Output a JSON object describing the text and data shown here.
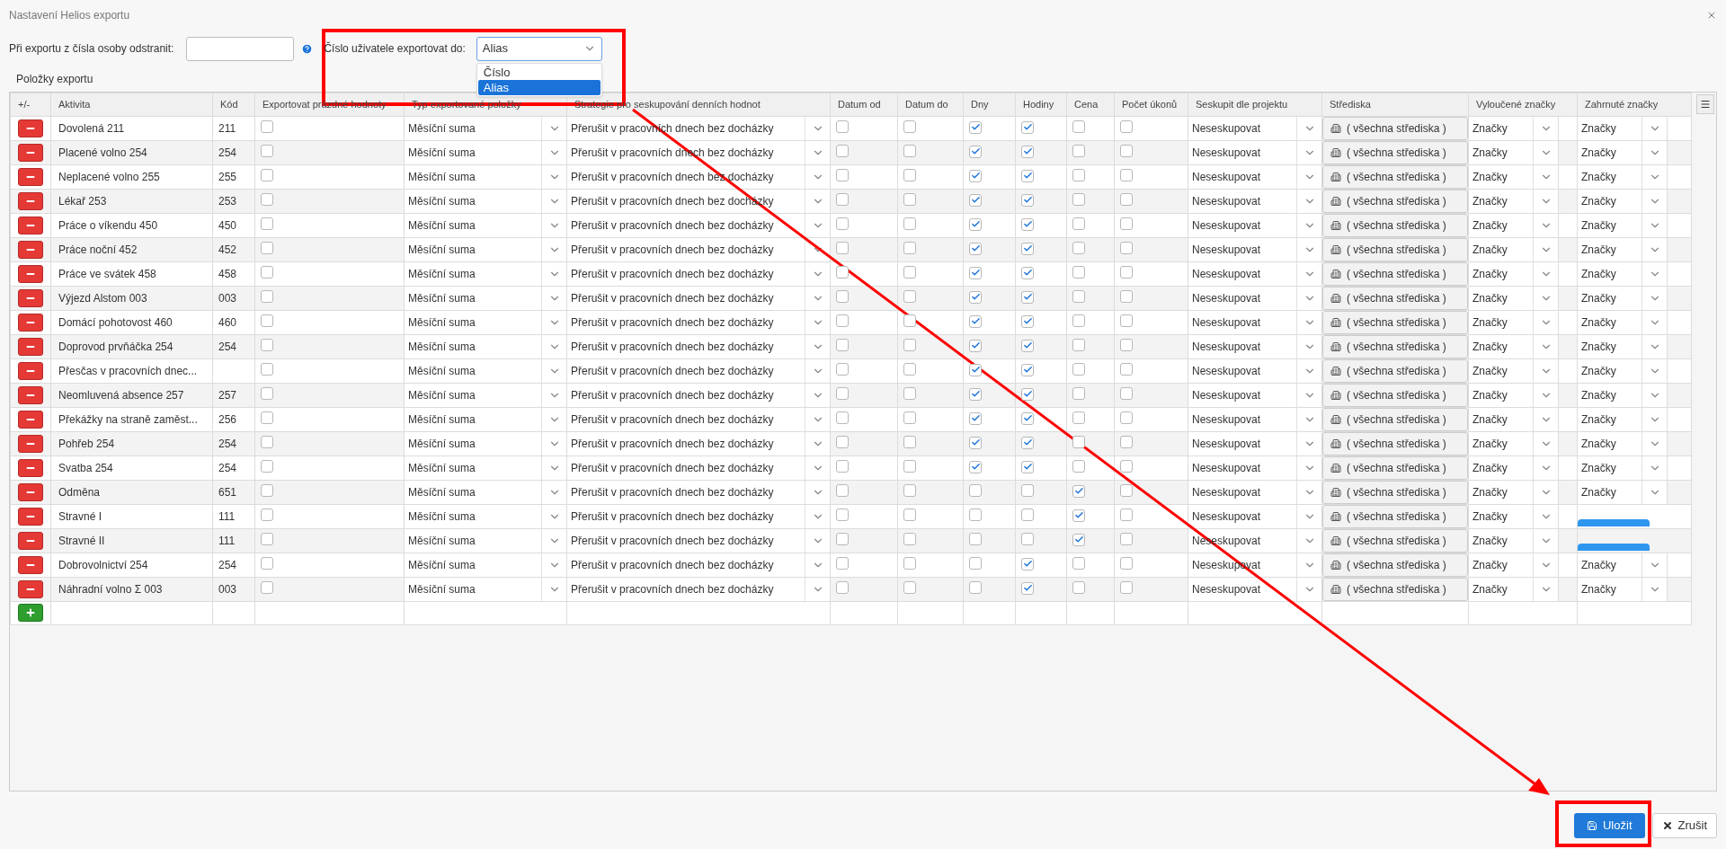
{
  "window": {
    "title": "Nastavení Helios exportu"
  },
  "form": {
    "remove_label": "Při exportu z čísla osoby odstranit:",
    "user_number_label": "Číslo uživatele exportovat do:",
    "user_number_value": "Alias",
    "dropdown_open": true,
    "options": [
      {
        "label": "Číslo",
        "selected": false
      },
      {
        "label": "Alias",
        "selected": true
      }
    ]
  },
  "section_title": "Položky exportu",
  "columns": [
    "+/-",
    "Aktivita",
    "Kód",
    "Exportovat prázdné hodnoty",
    "Typ exportované položky",
    "Strategie pro seskupování denních hodnot",
    "Datum od",
    "Datum do",
    "Dny",
    "Hodiny",
    "Cena",
    "Počet úkonů",
    "Seskupit dle projektu",
    "Střediska",
    "Vyloučené značky",
    "Zahrnuté značky"
  ],
  "rows": [
    {
      "activity": "Dovolená 211",
      "code": "211",
      "export_empty": false,
      "type": "Měsíční suma",
      "strategy": "Přerušit v pracovních dnech bez docházky",
      "date_from": false,
      "date_to": false,
      "days": true,
      "hours": true,
      "price": false,
      "count": false,
      "group": "Neseskupovat",
      "centers": "( všechna střediska )",
      "excluded": "Značky",
      "included": "Značky"
    },
    {
      "activity": "Placené volno 254",
      "code": "254",
      "export_empty": false,
      "type": "Měsíční suma",
      "strategy": "Přerušit v pracovních dnech bez docházky",
      "date_from": false,
      "date_to": false,
      "days": true,
      "hours": true,
      "price": false,
      "count": false,
      "group": "Neseskupovat",
      "centers": "( všechna střediska )",
      "excluded": "Značky",
      "included": "Značky"
    },
    {
      "activity": "Neplacené volno 255",
      "code": "255",
      "export_empty": false,
      "type": "Měsíční suma",
      "strategy": "Přerušit v pracovních dnech bez docházky",
      "date_from": false,
      "date_to": false,
      "days": true,
      "hours": true,
      "price": false,
      "count": false,
      "group": "Neseskupovat",
      "centers": "( všechna střediska )",
      "excluded": "Značky",
      "included": "Značky"
    },
    {
      "activity": "Lékař 253",
      "code": "253",
      "export_empty": false,
      "type": "Měsíční suma",
      "strategy": "Přerušit v pracovních dnech bez docházky",
      "date_from": false,
      "date_to": false,
      "days": true,
      "hours": true,
      "price": false,
      "count": false,
      "group": "Neseskupovat",
      "centers": "( všechna střediska )",
      "excluded": "Značky",
      "included": "Značky"
    },
    {
      "activity": "Práce o víkendu 450",
      "code": "450",
      "export_empty": false,
      "type": "Měsíční suma",
      "strategy": "Přerušit v pracovních dnech bez docházky",
      "date_from": false,
      "date_to": false,
      "days": true,
      "hours": true,
      "price": false,
      "count": false,
      "group": "Neseskupovat",
      "centers": "( všechna střediska )",
      "excluded": "Značky",
      "included": "Značky"
    },
    {
      "activity": "Práce noční 452",
      "code": "452",
      "export_empty": false,
      "type": "Měsíční suma",
      "strategy": "Přerušit v pracovních dnech bez docházky",
      "date_from": false,
      "date_to": false,
      "days": true,
      "hours": true,
      "price": false,
      "count": false,
      "group": "Neseskupovat",
      "centers": "( všechna střediska )",
      "excluded": "Značky",
      "included": "Značky"
    },
    {
      "activity": "Práce ve svátek 458",
      "code": "458",
      "export_empty": false,
      "type": "Měsíční suma",
      "strategy": "Přerušit v pracovních dnech bez docházky",
      "date_from": false,
      "date_to": false,
      "days": true,
      "hours": true,
      "price": false,
      "count": false,
      "group": "Neseskupovat",
      "centers": "( všechna střediska )",
      "excluded": "Značky",
      "included": "Značky"
    },
    {
      "activity": "Výjezd Alstom 003",
      "code": "003",
      "export_empty": false,
      "type": "Měsíční suma",
      "strategy": "Přerušit v pracovních dnech bez docházky",
      "date_from": false,
      "date_to": false,
      "days": true,
      "hours": true,
      "price": false,
      "count": false,
      "group": "Neseskupovat",
      "centers": "( všechna střediska )",
      "excluded": "Značky",
      "included": "Značky"
    },
    {
      "activity": "Domácí pohotovost 460",
      "code": "460",
      "export_empty": false,
      "type": "Měsíční suma",
      "strategy": "Přerušit v pracovních dnech bez docházky",
      "date_from": false,
      "date_to": false,
      "days": true,
      "hours": true,
      "price": false,
      "count": false,
      "group": "Neseskupovat",
      "centers": "( všechna střediska )",
      "excluded": "Značky",
      "included": "Značky"
    },
    {
      "activity": "Doprovod prvňáčka 254",
      "code": "254",
      "export_empty": false,
      "type": "Měsíční suma",
      "strategy": "Přerušit v pracovních dnech bez docházky",
      "date_from": false,
      "date_to": false,
      "days": true,
      "hours": true,
      "price": false,
      "count": false,
      "group": "Neseskupovat",
      "centers": "( všechna střediska )",
      "excluded": "Značky",
      "included": "Značky"
    },
    {
      "activity": "Přesčas v pracovních dnec...",
      "export_empty": false,
      "type": "Měsíční suma",
      "strategy": "Přerušit v pracovních dnech bez docházky",
      "date_from": false,
      "date_to": false,
      "days": true,
      "hours": true,
      "price": false,
      "count": false,
      "group": "Neseskupovat",
      "centers": "( všechna střediska )",
      "excluded": "Značky",
      "included": "Značky"
    },
    {
      "activity": "Neomluvená absence 257",
      "code": "257",
      "export_empty": false,
      "type": "Měsíční suma",
      "strategy": "Přerušit v pracovních dnech bez docházky",
      "date_from": false,
      "date_to": false,
      "days": true,
      "hours": true,
      "price": false,
      "count": false,
      "group": "Neseskupovat",
      "centers": "( všechna střediska )",
      "excluded": "Značky",
      "included": "Značky"
    },
    {
      "activity": "Překážky na straně zaměst...",
      "code": "256",
      "export_empty": false,
      "type": "Měsíční suma",
      "strategy": "Přerušit v pracovních dnech bez docházky",
      "date_from": false,
      "date_to": false,
      "days": true,
      "hours": true,
      "price": false,
      "count": false,
      "group": "Neseskupovat",
      "centers": "( všechna střediska )",
      "excluded": "Značky",
      "included": "Značky"
    },
    {
      "activity": "Pohřeb 254",
      "code": "254",
      "export_empty": false,
      "type": "Měsíční suma",
      "strategy": "Přerušit v pracovních dnech bez docházky",
      "date_from": false,
      "date_to": false,
      "days": true,
      "hours": true,
      "price": false,
      "count": false,
      "group": "Neseskupovat",
      "centers": "( všechna střediska )",
      "excluded": "Značky",
      "included": "Značky"
    },
    {
      "activity": "Svatba 254",
      "code": "254",
      "export_empty": false,
      "type": "Měsíční suma",
      "strategy": "Přerušit v pracovních dnech bez docházky",
      "date_from": false,
      "date_to": false,
      "days": true,
      "hours": true,
      "price": false,
      "count": false,
      "group": "Neseskupovat",
      "centers": "( všechna střediska )",
      "excluded": "Značky",
      "included": "Značky"
    },
    {
      "activity": "Odměna",
      "code": "651",
      "export_empty": false,
      "type": "Měsíční suma",
      "strategy": "Přerušit v pracovních dnech bez docházky",
      "date_from": false,
      "date_to": false,
      "days": false,
      "hours": false,
      "price": true,
      "count": false,
      "group": "Neseskupovat",
      "centers": "( všechna střediska )",
      "excluded": "Značky",
      "included": "Značky"
    },
    {
      "activity": "Stravné I",
      "code": "111",
      "export_empty": false,
      "type": "Měsíční suma",
      "strategy": "Přerušit v pracovních dnech bez docházky",
      "date_from": false,
      "date_to": false,
      "days": false,
      "hours": false,
      "price": true,
      "count": false,
      "group": "Neseskupovat",
      "centers": "( všechna střediska )",
      "excluded": "Značky"
    },
    {
      "activity": "Stravné II",
      "code": "111",
      "export_empty": false,
      "type": "Měsíční suma",
      "strategy": "Přerušit v pracovních dnech bez docházky",
      "date_from": false,
      "date_to": false,
      "days": false,
      "hours": false,
      "price": true,
      "count": false,
      "group": "Neseskupovat",
      "centers": "( všechna střediska )",
      "excluded": "Značky"
    },
    {
      "activity": "Dobrovolnictví 254",
      "code": "254",
      "export_empty": false,
      "type": "Měsíční suma",
      "strategy": "Přerušit v pracovních dnech bez docházky",
      "date_from": false,
      "date_to": false,
      "days": false,
      "hours": true,
      "price": false,
      "count": false,
      "group": "Neseskupovat",
      "centers": "( všechna střediska )",
      "excluded": "Značky",
      "included": "Značky"
    },
    {
      "activity": "Náhradní volno Σ 003",
      "code": "003",
      "export_empty": false,
      "type": "Měsíční suma",
      "strategy": "Přerušit v pracovních dnech bez docházky",
      "date_from": false,
      "date_to": false,
      "days": false,
      "hours": true,
      "price": false,
      "count": false,
      "group": "Neseskupovat",
      "centers": "( všechna střediska )",
      "excluded": "Značky",
      "included": "Značky"
    }
  ],
  "buttons": {
    "save": "Uložit",
    "cancel": "Zrušit"
  }
}
